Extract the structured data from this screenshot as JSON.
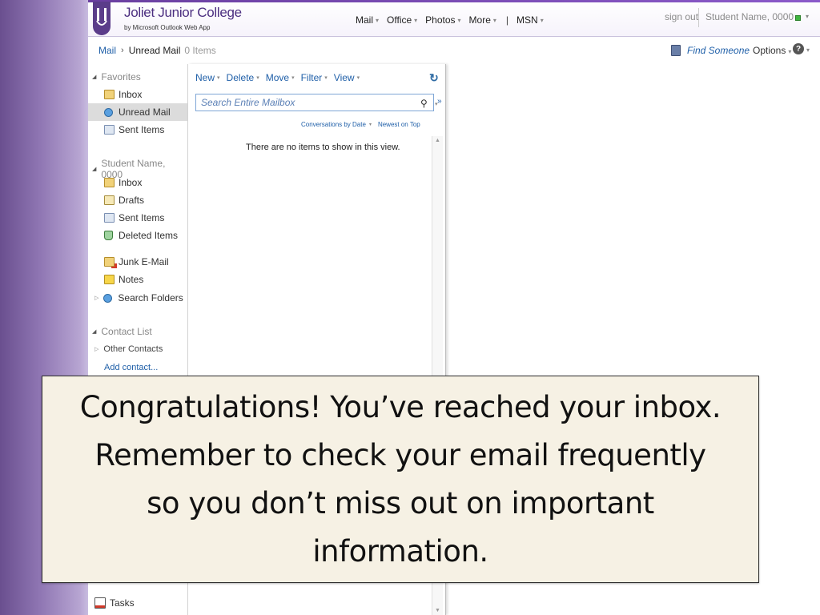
{
  "header": {
    "college_name": "Joliet Junior College",
    "college_sub": "by Microsoft Outlook Web App",
    "nav": [
      {
        "label": "Mail",
        "caret": "▾"
      },
      {
        "label": "Office",
        "caret": "▾"
      },
      {
        "label": "Photos",
        "caret": "▾"
      },
      {
        "label": "More",
        "caret": "▾"
      }
    ],
    "separator": "|",
    "msn": "MSN",
    "signout": "sign out",
    "username": "Student Name, 0000"
  },
  "breadcrumb": {
    "root": "Mail",
    "chevron": "›",
    "current": "Unread Mail",
    "count": "0 Items"
  },
  "utility": {
    "find_someone": "Find Someone",
    "options": "Options",
    "help": "?"
  },
  "leftnav": {
    "favorites_label": "Favorites",
    "favorites": [
      {
        "label": "Inbox",
        "icon": "inbox-icon"
      },
      {
        "label": "Unread Mail",
        "icon": "search-folder-icon"
      },
      {
        "label": "Sent Items",
        "icon": "sent-icon"
      }
    ],
    "mailbox_label": "Student Name, 0000",
    "mailbox": [
      {
        "label": "Inbox",
        "icon": "inbox-icon"
      },
      {
        "label": "Drafts",
        "icon": "drafts-icon"
      },
      {
        "label": "Sent Items",
        "icon": "sent-icon"
      },
      {
        "label": "Deleted Items",
        "icon": "deleted-icon"
      },
      {
        "label": "Junk E-Mail",
        "icon": "junk-icon"
      },
      {
        "label": "Notes",
        "icon": "notes-icon"
      },
      {
        "label": "Search Folders",
        "icon": "search-folder-icon"
      }
    ],
    "contacts_label": "Contact List",
    "other_contacts": "Other Contacts",
    "add_contact": "Add contact...",
    "tasks": "Tasks"
  },
  "listpane": {
    "toolbar": [
      "New",
      "Delete",
      "Move",
      "Filter",
      "View"
    ],
    "search_placeholder": "Search Entire Mailbox",
    "sort_by": "Conversations by Date",
    "sort_order": "Newest on Top",
    "empty_message": "There are no items to show in this view."
  },
  "callout": {
    "text": "Congratulations! You’ve reached your inbox. Remember to check your email frequently so you don’t miss out on important information."
  },
  "colors": {
    "accent": "#4b2e80",
    "link": "#1f5fa8",
    "callout_bg": "#f6f1e4"
  }
}
